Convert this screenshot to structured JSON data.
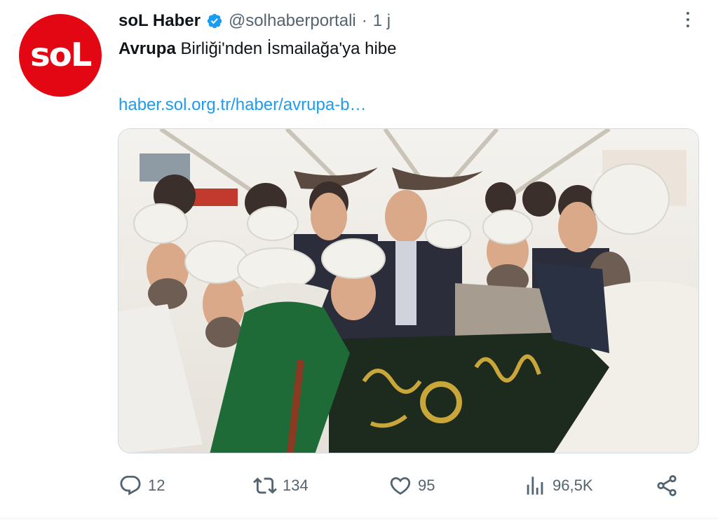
{
  "tweet": {
    "avatar_text": "soL",
    "display_name": "soL Haber",
    "handle": "@solhaberportali",
    "separator": "·",
    "time": "1 j",
    "text_bold": "Avrupa",
    "text_rest": " Birliği'nden İsmailağa'ya hibe",
    "link": "haber.sol.org.tr/haber/avrupa-b…",
    "verified_icon": "verified-badge-icon",
    "colors": {
      "brand_red": "#e30613",
      "link_blue": "#1d9bf0",
      "muted": "#536471",
      "text": "#0f1419"
    }
  },
  "actions": {
    "reply_count": "12",
    "retweet_count": "134",
    "like_count": "95",
    "views_count": "96,5K"
  }
}
